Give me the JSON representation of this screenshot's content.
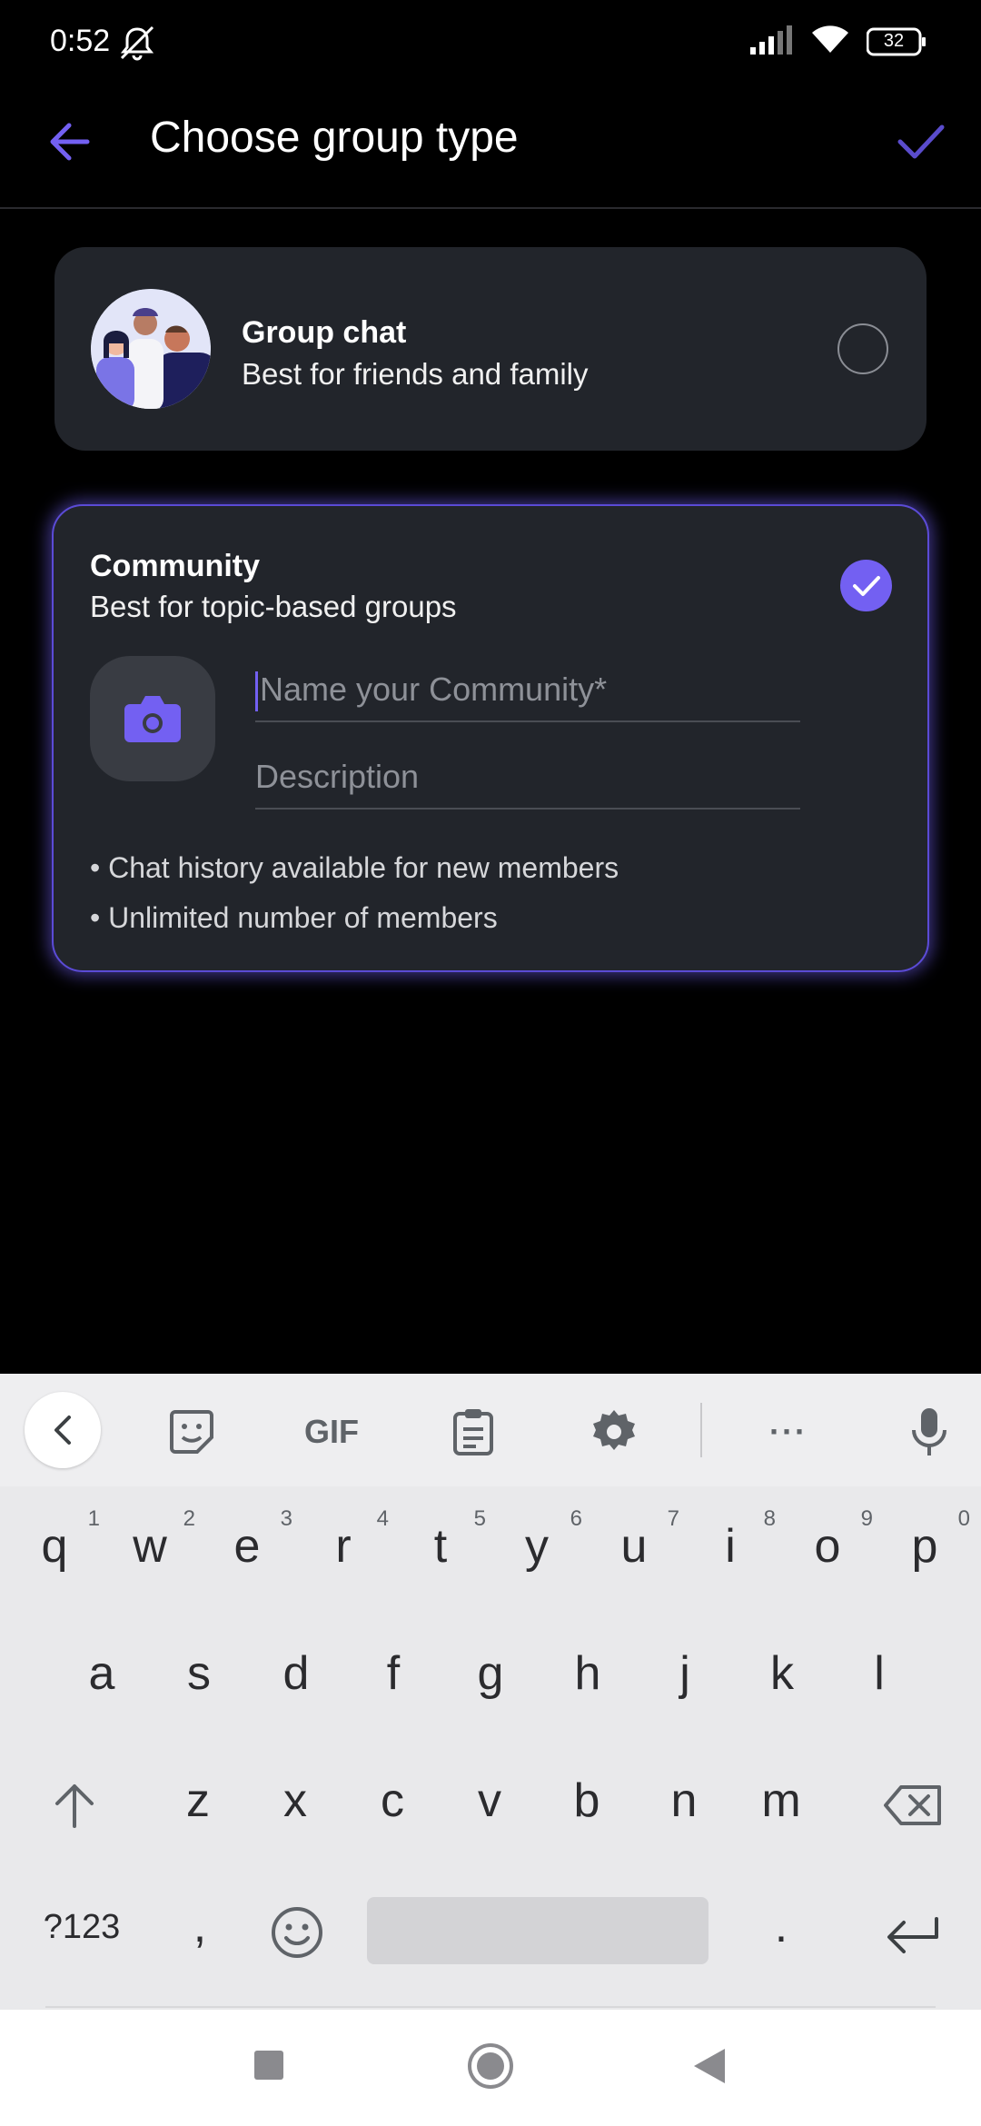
{
  "status_bar": {
    "time": "0:52",
    "battery": "32"
  },
  "app_bar": {
    "title": "Choose group type"
  },
  "group_chat": {
    "title": "Group chat",
    "subtitle": "Best for friends and family"
  },
  "community": {
    "title": "Community",
    "subtitle": "Best for topic-based groups",
    "name_placeholder": "Name your Community*",
    "description_placeholder": "Description",
    "bullets": [
      "• Chat history available for new members",
      "• Unlimited number of members"
    ]
  },
  "keyboard": {
    "toolbar": {
      "gif_label": "GIF",
      "more_label": "···"
    },
    "row1": [
      {
        "k": "q",
        "n": "1"
      },
      {
        "k": "w",
        "n": "2"
      },
      {
        "k": "e",
        "n": "3"
      },
      {
        "k": "r",
        "n": "4"
      },
      {
        "k": "t",
        "n": "5"
      },
      {
        "k": "y",
        "n": "6"
      },
      {
        "k": "u",
        "n": "7"
      },
      {
        "k": "i",
        "n": "8"
      },
      {
        "k": "o",
        "n": "9"
      },
      {
        "k": "p",
        "n": "0"
      }
    ],
    "row2": [
      "a",
      "s",
      "d",
      "f",
      "g",
      "h",
      "j",
      "k",
      "l"
    ],
    "row3": [
      "z",
      "x",
      "c",
      "v",
      "b",
      "n",
      "m"
    ],
    "symbols_label": "?123",
    "comma": ",",
    "period": "."
  },
  "colors": {
    "accent": "#7360f2",
    "card": "#22252b",
    "background": "#000000"
  }
}
